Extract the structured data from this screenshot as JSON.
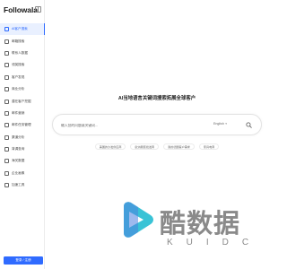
{
  "app": {
    "brand": "Followala"
  },
  "sidebar": {
    "items": [
      {
        "label": "AI客户搜索",
        "icon": "ai-search-icon",
        "active": true
      },
      {
        "label": "邮箱搜索",
        "icon": "mail-icon"
      },
      {
        "label": "联系人数据",
        "icon": "contacts-icon"
      },
      {
        "label": "领英搜索",
        "icon": "linkedin-icon"
      },
      {
        "label": "客户发现",
        "icon": "discover-icon"
      },
      {
        "label": "商业分析",
        "icon": "chart-icon"
      },
      {
        "label": "潜在客户挖掘",
        "icon": "target-icon"
      },
      {
        "label": "邮件营销",
        "icon": "send-icon"
      },
      {
        "label": "邮件任务管理",
        "icon": "task-icon"
      },
      {
        "label": "渠道分析",
        "icon": "analysis-icon"
      },
      {
        "label": "背调查询",
        "icon": "check-icon"
      },
      {
        "label": "海关数据",
        "icon": "customs-icon"
      },
      {
        "label": "企业画像",
        "icon": "company-icon"
      },
      {
        "label": "加速工具",
        "icon": "tool-icon"
      }
    ],
    "login_label": "登录 / 注册"
  },
  "main": {
    "title": "AI当地语言关键词搜索拓展全球客户",
    "search": {
      "placeholder": "输入您的问题或关键词...",
      "language": "English",
      "button_icon": "search-icon"
    },
    "chips": [
      "美国的沙发供应商",
      "欧洲服装批发商",
      "我的德国客户需求",
      "家具电商"
    ]
  },
  "watermark": {
    "text": "酷数据",
    "subtext": "KUIDC"
  },
  "colors": {
    "accent": "#2f6bff",
    "active_bg": "#e9f0ff",
    "watermark": "#8a8a8a"
  }
}
